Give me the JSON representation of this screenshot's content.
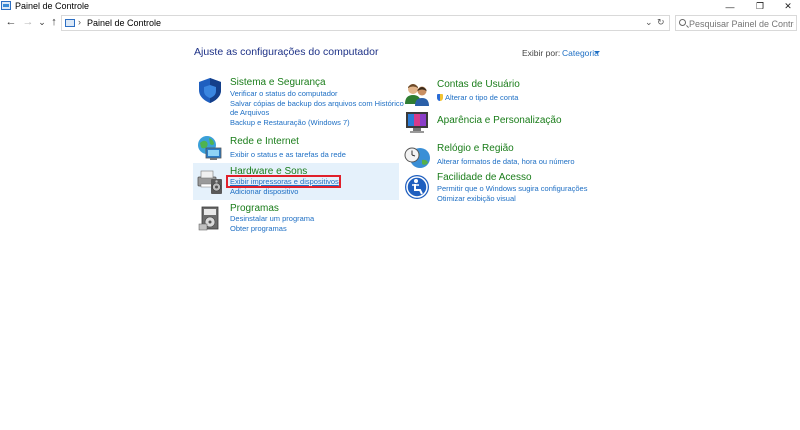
{
  "window": {
    "title": "Painel de Controle",
    "min_symbol": "—",
    "max_symbol": "❐",
    "close_symbol": "✕"
  },
  "nav": {
    "back_icon": "←",
    "forward_icon": "→",
    "dropdown_icon": "⌄",
    "up_icon": "↑",
    "breadcrumb_separator": "›",
    "location": "Painel de Controle",
    "address_dropdown": "⌄",
    "refresh_icon": "↻",
    "search_placeholder": "Pesquisar Painel de Controle"
  },
  "main": {
    "heading": "Ajuste as configurações do computador",
    "view_by_label": "Exibir por:",
    "view_by_value": "Categoria"
  },
  "left_categories": [
    {
      "title": "Sistema e Segurança",
      "icon": "shield-icon",
      "links": [
        "Verificar o status do computador",
        "Salvar cópias de backup dos arquivos com Histórico",
        "de Arquivos",
        "Backup e Restauração (Windows 7)"
      ]
    },
    {
      "title": "Rede e Internet",
      "icon": "network-globe-icon",
      "links": [
        "Exibir o status e as tarefas da rede"
      ]
    },
    {
      "title": "Hardware e Sons",
      "icon": "printer-speaker-icon",
      "links": [
        "Exibir impressoras e dispositivos",
        "Adicionar dispositivo"
      ]
    },
    {
      "title": "Programas",
      "icon": "programs-icon",
      "links": [
        "Desinstalar um programa",
        "Obter programas"
      ]
    }
  ],
  "right_categories": [
    {
      "title": "Contas de Usuário",
      "icon": "users-icon",
      "links": [
        "Alterar o tipo de conta"
      ]
    },
    {
      "title": "Aparência e Personalização",
      "icon": "monitor-palette-icon",
      "links": []
    },
    {
      "title": "Relógio e Região",
      "icon": "clock-globe-icon",
      "links": [
        "Alterar formatos de data, hora ou número"
      ]
    },
    {
      "title": "Facilidade de Acesso",
      "icon": "accessibility-icon",
      "links": [
        "Permitir que o Windows sugira configurações",
        "Otimizar exibição visual"
      ]
    }
  ],
  "colors": {
    "category_title": "#1a7d1a",
    "link": "#1e6fc4",
    "heading": "#1e3287",
    "highlight_bg": "#e5f1fb",
    "annotation_box": "#e0202a"
  }
}
